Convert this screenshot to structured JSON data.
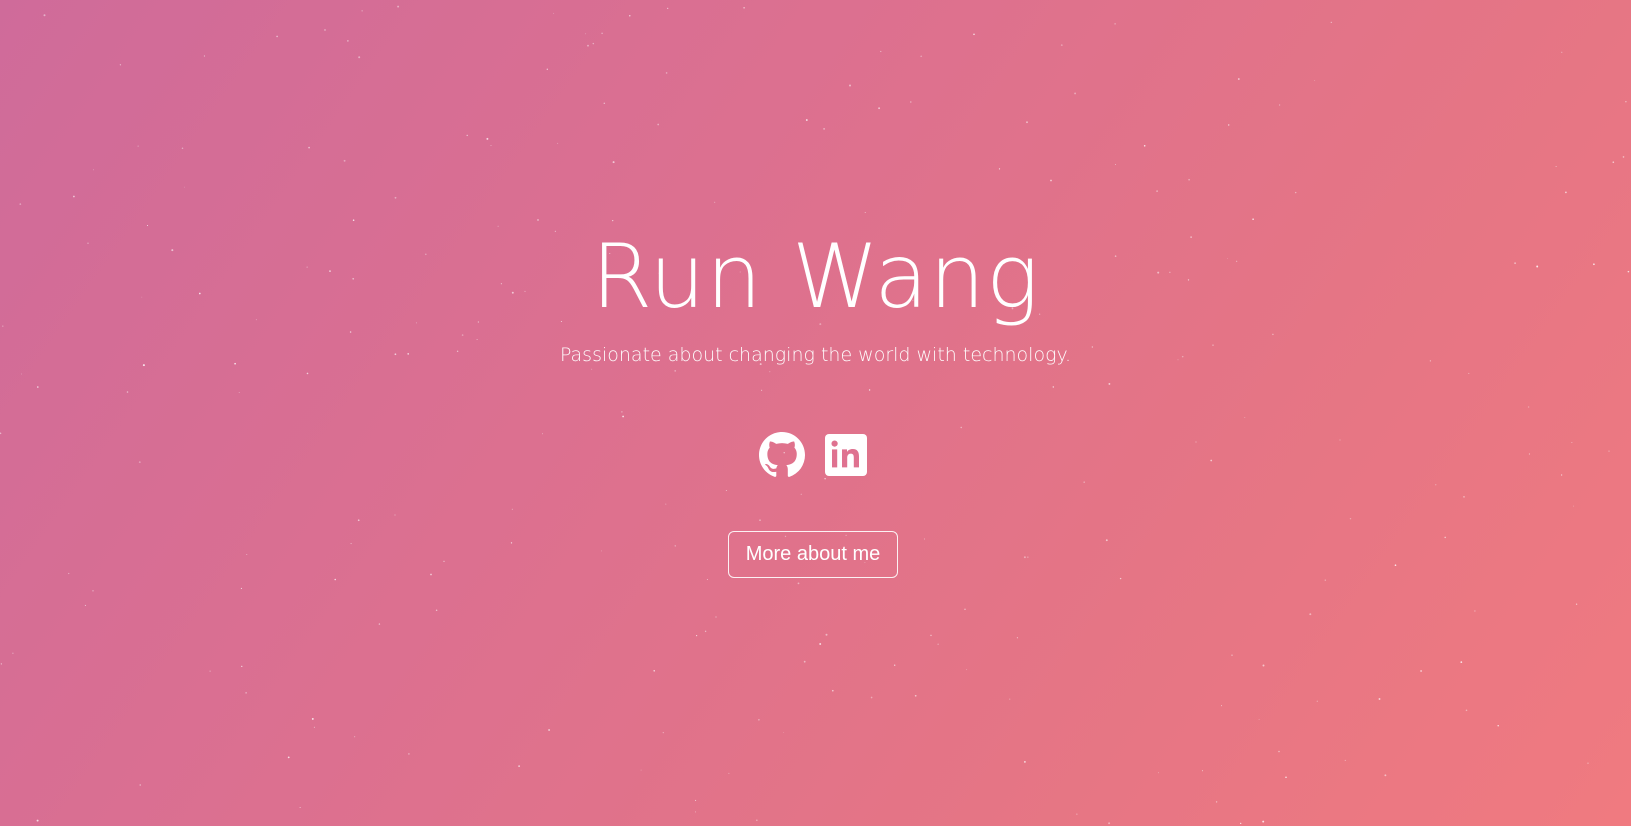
{
  "theme": {
    "gradient_start": "#cf6b9a",
    "gradient_end": "#f07a80",
    "text_color": "#ffffff",
    "star_color": "#ffffff"
  },
  "hero": {
    "title": "Run Wang",
    "subtitle": "Passionate about changing the world with technology."
  },
  "social": {
    "links": [
      {
        "name": "github",
        "icon": "github-icon"
      },
      {
        "name": "linkedin",
        "icon": "linkedin-icon"
      }
    ]
  },
  "cta": {
    "label": "More about me"
  }
}
